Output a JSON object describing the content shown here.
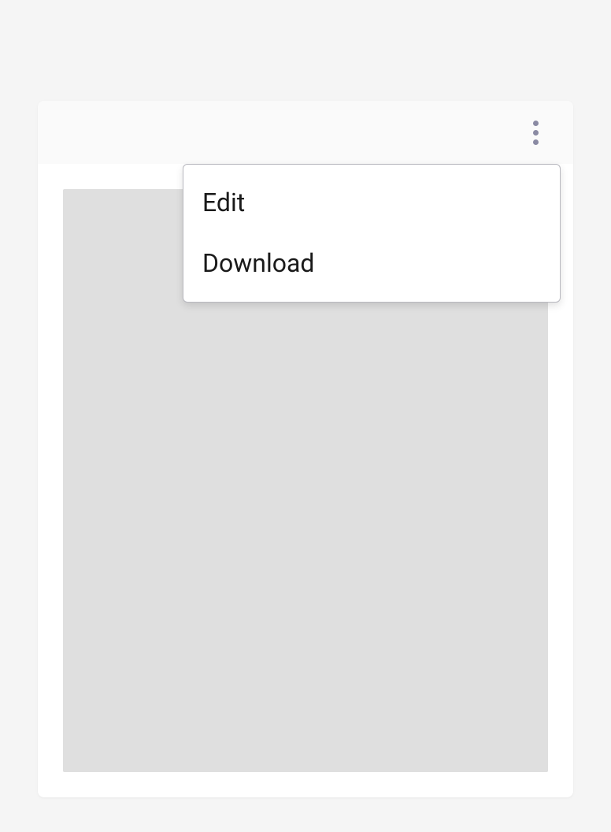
{
  "menu": {
    "items": [
      {
        "label": "Edit"
      },
      {
        "label": "Download"
      }
    ]
  }
}
